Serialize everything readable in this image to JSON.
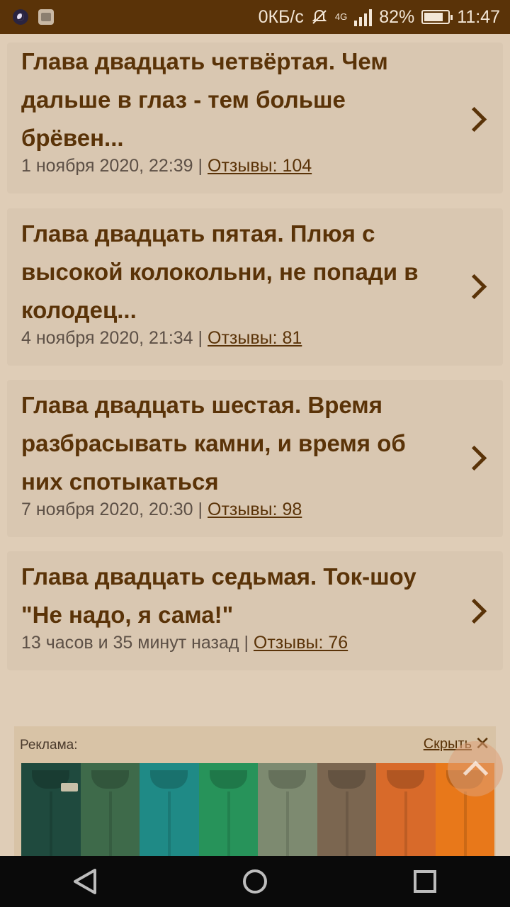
{
  "status_bar": {
    "speed": "0КБ/с",
    "network": "4G",
    "battery_percent": "82%",
    "battery_level": 0.82,
    "time": "11:47"
  },
  "chapters": [
    {
      "title": "Глава двадцать четвёртая. Чем дальше в глаз - тем больше брёвен...",
      "date": "1 ноября 2020, 22:39",
      "separator": "|",
      "reviews": "Отзывы: 104"
    },
    {
      "title": "Глава двадцать пятая. Плюя с высокой колокольни, не попади в колодец...",
      "date": "4 ноября 2020, 21:34",
      "separator": "|",
      "reviews": "Отзывы: 81"
    },
    {
      "title": "Глава двадцать шестая. Время разбрасывать камни, и время об них спотыкаться",
      "date": "7 ноября 2020, 20:30",
      "separator": "|",
      "reviews": "Отзывы: 98"
    },
    {
      "title": "Глава двадцать седьмая. Ток-шоу \"Не надо, я сама!\"",
      "date": "13 часов и 35 минут назад",
      "separator": "|",
      "reviews": "Отзывы: 76"
    }
  ],
  "ad": {
    "label": "Реклама:",
    "hide": "Скрыть",
    "close_icon": "✕",
    "image_colors": [
      "#1f4a3e",
      "#3e6a4a",
      "#1f8a86",
      "#27935a",
      "#7d8a70",
      "#7b6650",
      "#d86a2a",
      "#e8781a"
    ]
  },
  "colors": {
    "status_bar": "#5a3308",
    "accent": "#5a3308",
    "background": "#dfcdb7",
    "card": "#d9c7b1"
  }
}
